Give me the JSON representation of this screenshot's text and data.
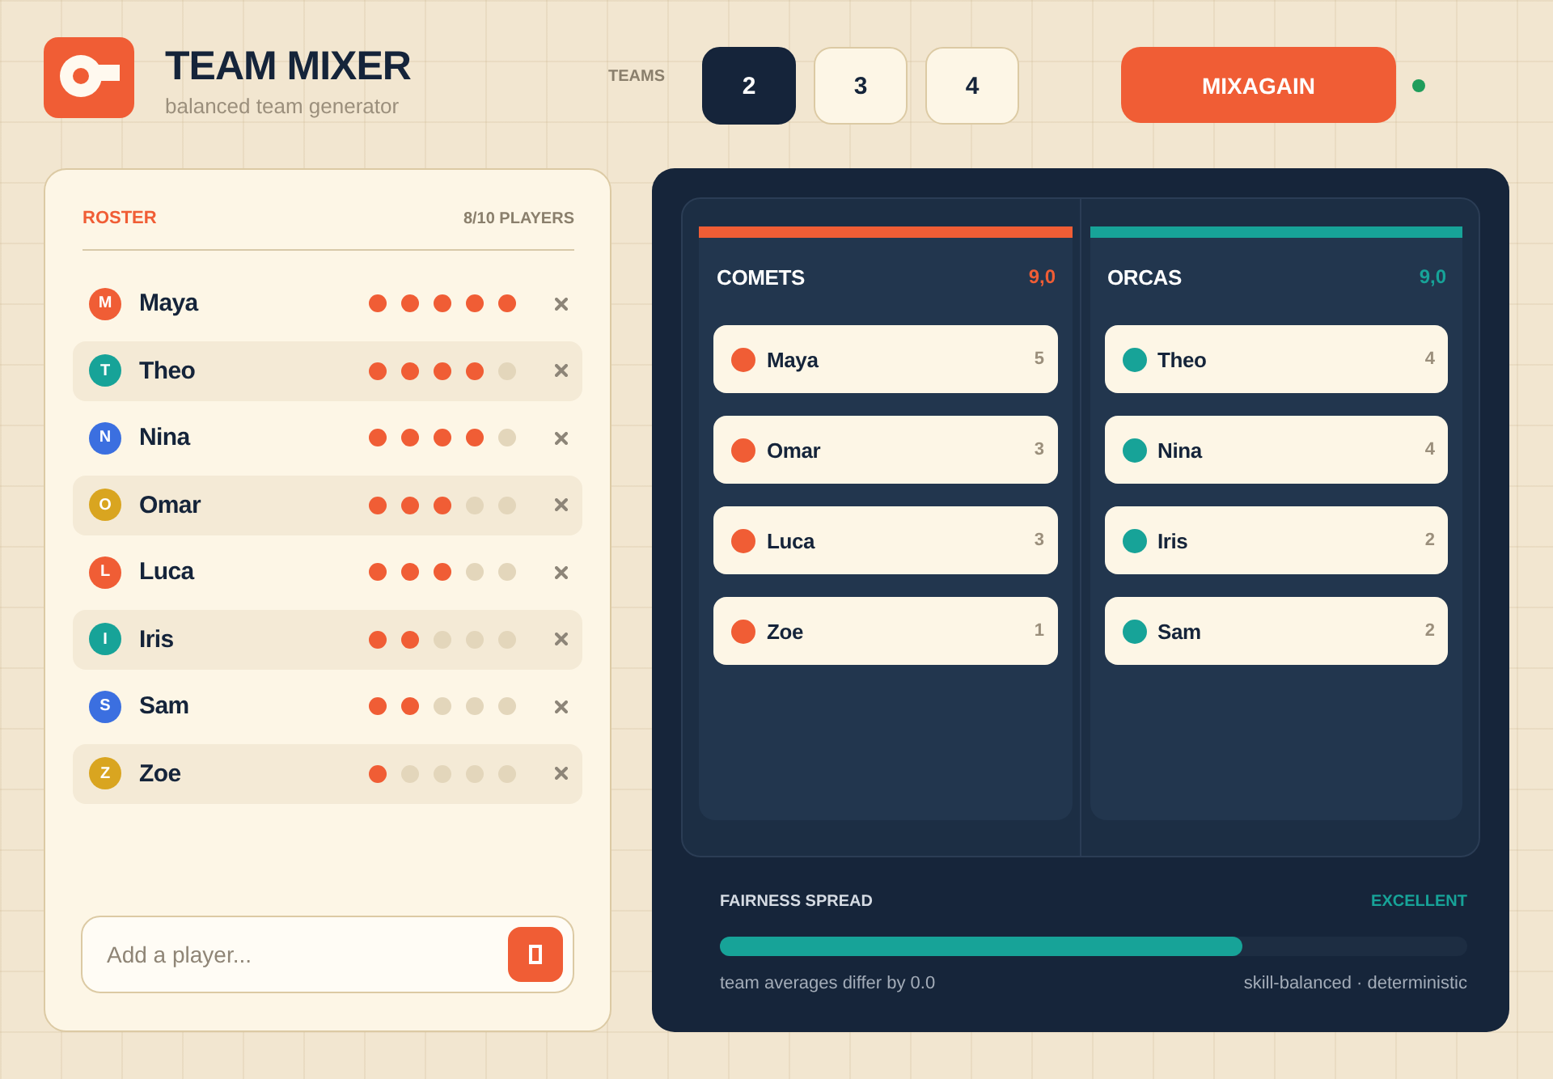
{
  "header": {
    "title": "TEAM MIXER",
    "subtitle": "balanced team generator"
  },
  "team_count": {
    "label": "TEAMS",
    "options": [
      {
        "label": "2",
        "selected": true
      },
      {
        "label": "3",
        "selected": false
      },
      {
        "label": "4",
        "selected": false
      }
    ]
  },
  "mix_button": {
    "label": "MIXAGAIN"
  },
  "roster": {
    "title": "ROSTER",
    "count": "8/10 PLAYERS",
    "players": [
      {
        "initial": "M",
        "name": "Maya",
        "color": "#f05d35",
        "stars": 5
      },
      {
        "initial": "T",
        "name": "Theo",
        "color": "#17a398",
        "stars": 4
      },
      {
        "initial": "N",
        "name": "Nina",
        "color": "#3b6fe0",
        "stars": 4
      },
      {
        "initial": "O",
        "name": "Omar",
        "color": "#d9a520",
        "stars": 3
      },
      {
        "initial": "L",
        "name": "Luca",
        "color": "#f05d35",
        "stars": 3
      },
      {
        "initial": "I",
        "name": "Iris",
        "color": "#17a398",
        "stars": 2
      },
      {
        "initial": "S",
        "name": "Sam",
        "color": "#3b6fe0",
        "stars": 2
      },
      {
        "initial": "Z",
        "name": "Zoe",
        "color": "#d9a520",
        "stars": 1
      }
    ],
    "add_field": {
      "placeholder": "Add a player..."
    }
  },
  "board": {
    "teams": [
      {
        "name": "COMETS",
        "score": "9,0",
        "color": "#f05d35",
        "players": [
          {
            "name": "Maya",
            "skill": "5"
          },
          {
            "name": "Omar",
            "skill": "3"
          },
          {
            "name": "Luca",
            "skill": "3"
          },
          {
            "name": "Zoe",
            "skill": "1"
          }
        ]
      },
      {
        "name": "ORCAS",
        "score": "9,0",
        "color": "#17a398",
        "players": [
          {
            "name": "Theo",
            "skill": "4"
          },
          {
            "name": "Nina",
            "skill": "4"
          },
          {
            "name": "Iris",
            "skill": "2"
          },
          {
            "name": "Sam",
            "skill": "2"
          }
        ]
      }
    ],
    "fairness": {
      "label": "FAIRNESS SPREAD",
      "rating": "EXCELLENT",
      "level": 0.7,
      "note": "team averages differ by 0.0",
      "mode": "skill-balanced · deterministic"
    }
  }
}
